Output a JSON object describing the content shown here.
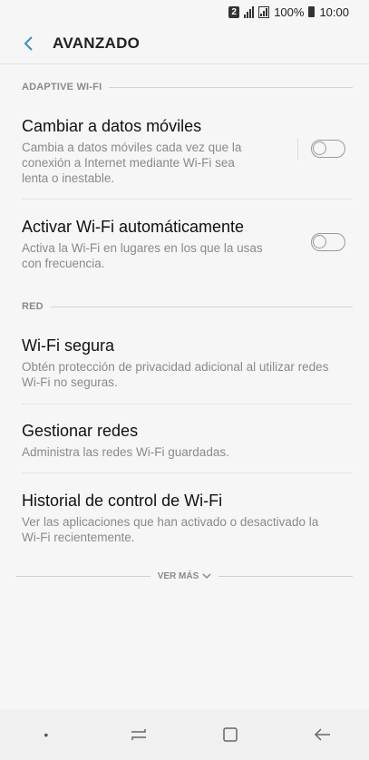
{
  "status_bar": {
    "sim_badge": "2",
    "battery_pct": "100%",
    "time": "10:00"
  },
  "header": {
    "title": "AVANZADO",
    "back_icon": "chevron-left-icon"
  },
  "sections": {
    "adaptive": {
      "label": "ADAPTIVE WI-FI"
    },
    "red": {
      "label": "RED"
    }
  },
  "items": {
    "cambiar": {
      "title": "Cambiar a datos móviles",
      "desc_lines": [
        "Cambia a datos móviles cada vez que la",
        "conexión a Internet mediante Wi-Fi sea",
        "lenta o inestable."
      ],
      "toggle_on": false
    },
    "activar": {
      "title": "Activar Wi-Fi automáticamente",
      "desc_lines": [
        "Activa la Wi-Fi en lugares en los que la usas",
        "con frecuencia."
      ],
      "toggle_on": false
    },
    "segura": {
      "title": "Wi-Fi segura",
      "desc_lines": [
        "Obtén protección de privacidad adicional al utilizar redes",
        "Wi-Fi no seguras."
      ]
    },
    "gestionar": {
      "title": "Gestionar redes",
      "desc_lines": [
        "Administra las redes Wi-Fi guardadas."
      ]
    },
    "historial": {
      "title": "Historial de control de Wi-Fi",
      "desc_lines": [
        "Ver las aplicaciones que han activado o desactivado la",
        "Wi-Fi recientemente."
      ]
    }
  },
  "more": {
    "label": "VER MÁS"
  },
  "nav": {
    "dot": "•",
    "recents_icon": "recent-apps-icon",
    "home_icon": "home-icon",
    "back_icon": "back-arrow-icon"
  },
  "colors": {
    "accent": "#3c8dbc",
    "background": "#f6f6f6",
    "secondary_text": "#8a8a8a"
  }
}
